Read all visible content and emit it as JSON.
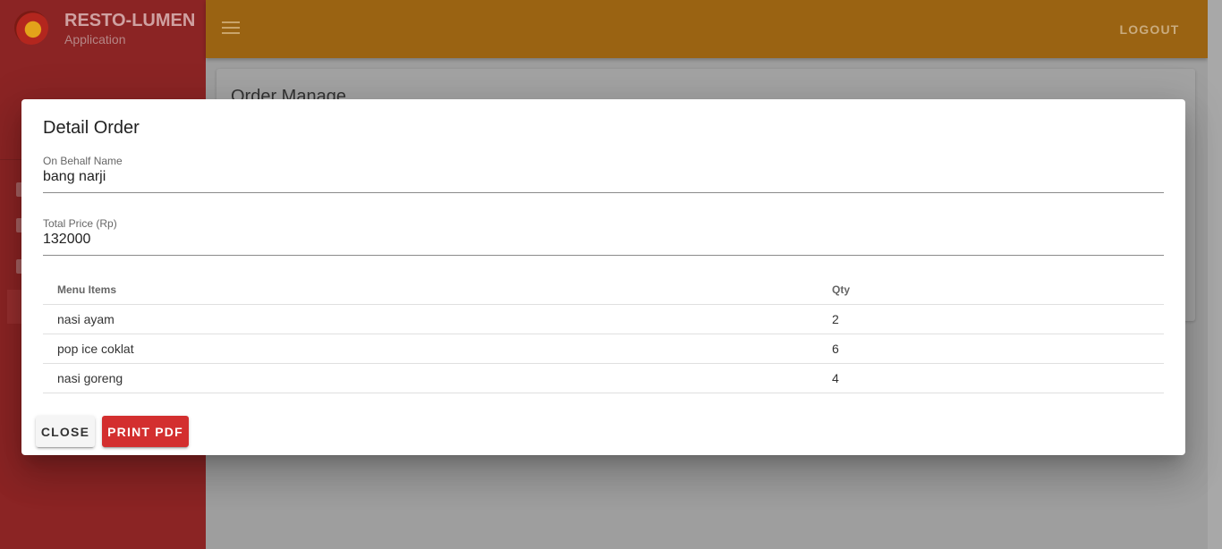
{
  "app": {
    "title": "RESTO-LUMEN",
    "subtitle": "Application"
  },
  "topbar": {
    "logout_label": "LOGOUT"
  },
  "page": {
    "title": "Order Manage"
  },
  "dialog": {
    "title": "Detail Order",
    "fields": [
      {
        "label": "On Behalf Name",
        "value": "bang narji"
      },
      {
        "label": "Total Price (Rp)",
        "value": "132000"
      }
    ],
    "table": {
      "headers": {
        "name": "Menu Items",
        "qty": "Qty"
      },
      "rows": [
        {
          "name": "nasi ayam",
          "qty": "2"
        },
        {
          "name": "pop ice coklat",
          "qty": "6"
        },
        {
          "name": "nasi goreng",
          "qty": "4"
        }
      ]
    },
    "buttons": {
      "close": "CLOSE",
      "print": "PRINT PDF"
    }
  },
  "colors": {
    "topbar": "#9a6312",
    "sidebar": "#8b2424",
    "print_button": "#d32f2f"
  }
}
